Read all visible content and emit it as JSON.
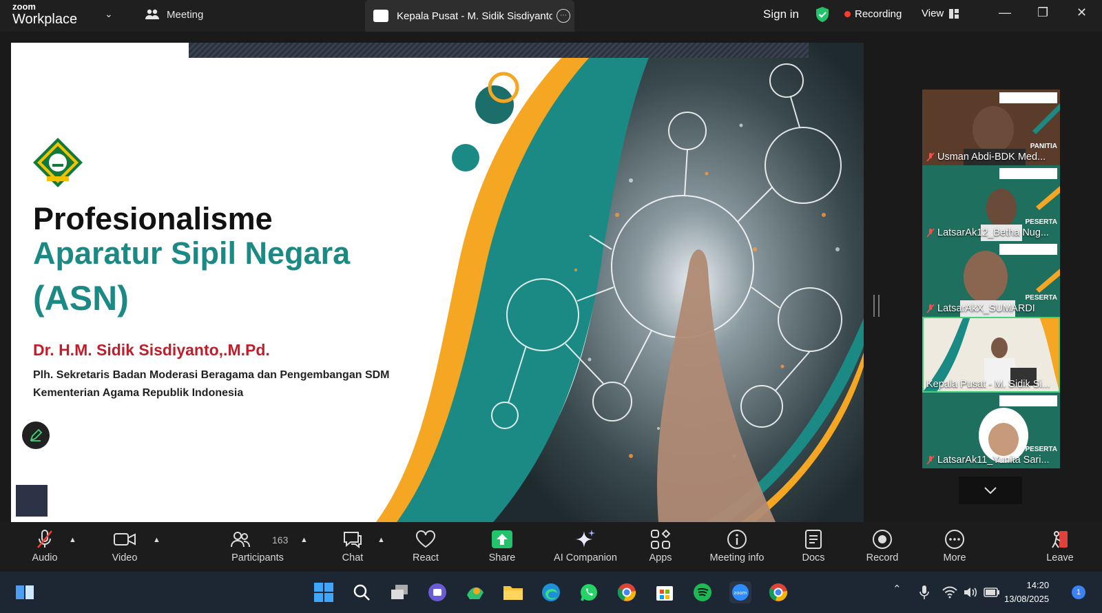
{
  "app": {
    "brand_small": "zoom",
    "brand_large": "Workplace"
  },
  "tabs": {
    "meeting": "Meeting",
    "active_title": "Kepala Pusat - M. Sidik Sisdiyantc"
  },
  "header": {
    "sign_in": "Sign in",
    "recording": "Recording",
    "view": "View"
  },
  "slide": {
    "title_line1": "Profesionalisme",
    "title_line2": "Aparatur Sipil Negara",
    "title_line3": "(ASN)",
    "author": "Dr. H.M. Sidik Sisdiyanto,.M.Pd.",
    "role_line1": "Plh. Sekretaris Badan Moderasi Beragama dan Pengembangan SDM",
    "role_line2": "Kementerian Agama Republik Indonesia"
  },
  "gallery": [
    {
      "name": "Usman Abdi-BDK Med...",
      "tag": "PANITIA",
      "bg": "#5b3b2a",
      "active": false
    },
    {
      "name": "LatsarAk12_Betha Nug...",
      "tag": "PESERTA",
      "bg": "#1f6f5e",
      "active": false
    },
    {
      "name": "LatsarAkX_SUMARDI",
      "tag": "PESERTA",
      "bg": "#1f6f5e",
      "active": false
    },
    {
      "name": "Kepala Pusat - M. Sidik Si...",
      "tag": "",
      "bg": "#e9e6dc",
      "active": true
    },
    {
      "name": "LatsarAk11_Yunita Sari...",
      "tag": "PESERTA",
      "bg": "#1f6f5e",
      "active": false
    }
  ],
  "toolbar": {
    "audio": "Audio",
    "video": "Video",
    "participants": "Participants",
    "participants_count": "163",
    "chat": "Chat",
    "react": "React",
    "share": "Share",
    "ai": "AI Companion",
    "apps": "Apps",
    "info": "Meeting info",
    "docs": "Docs",
    "record": "Record",
    "more": "More",
    "leave": "Leave"
  },
  "taskbar": {
    "time": "14:20",
    "date": "13/08/2025",
    "notifications": "1"
  },
  "colors": {
    "accent_teal": "#1c8a84",
    "author_red": "#c01e2a",
    "share_green": "#23c36b",
    "recording_red": "#ff3b30",
    "leave_red": "#e0413a"
  }
}
